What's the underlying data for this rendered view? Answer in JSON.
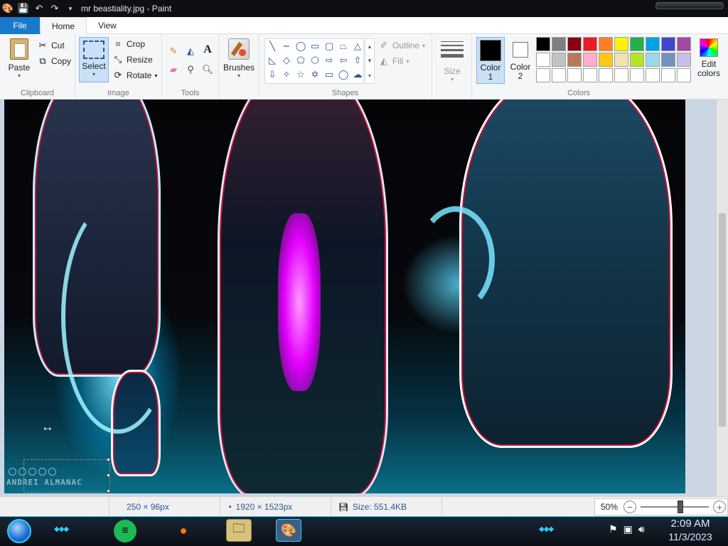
{
  "window": {
    "title": "mr beastiality.jpg - Paint"
  },
  "tabs": {
    "file": "File",
    "home": "Home",
    "view": "View"
  },
  "clipboard": {
    "paste": "Paste",
    "cut": "Cut",
    "copy": "Copy",
    "label": "Clipboard"
  },
  "image": {
    "select": "Select",
    "crop": "Crop",
    "resize": "Resize",
    "rotate": "Rotate",
    "label": "Image"
  },
  "tools": {
    "label": "Tools"
  },
  "brushes": {
    "label": "Brushes"
  },
  "shapes": {
    "label": "Shapes",
    "outline": "Outline",
    "fill": "Fill"
  },
  "size": {
    "label": "Size"
  },
  "colors": {
    "color1": "Color",
    "color1_num": "1",
    "color2": "Color",
    "color2_num": "2",
    "edit": "Edit",
    "edit2": "colors",
    "label": "Colors",
    "color1_value": "#000000",
    "color2_value": "#ffffff",
    "palette": [
      "#000000",
      "#7f7f7f",
      "#880015",
      "#ed1c24",
      "#ff7f27",
      "#fff200",
      "#22b14c",
      "#00a2e8",
      "#3f48cc",
      "#a349a4",
      "#ffffff",
      "#c3c3c3",
      "#b97a57",
      "#ffaec9",
      "#ffc90e",
      "#efe4b0",
      "#b5e61d",
      "#99d9ea",
      "#7092be",
      "#c8bfe7",
      "#ffffff",
      "#ffffff",
      "#ffffff",
      "#ffffff",
      "#ffffff",
      "#ffffff",
      "#ffffff",
      "#ffffff",
      "#ffffff",
      "#ffffff"
    ]
  },
  "canvas": {
    "watermark": "ANDREI ALMANAC"
  },
  "status": {
    "selection": "250 × 96px",
    "image_size": "1920 × 1523px",
    "file_size": "Size: 551.4KB",
    "zoom": "50%",
    "zoom_level_percent": 50
  },
  "taskbar": {
    "time": "2:09 AM",
    "date": "11/3/2023"
  }
}
